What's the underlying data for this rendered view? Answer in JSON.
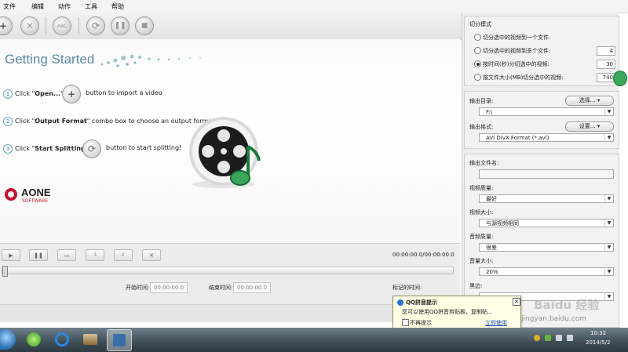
{
  "menu": {
    "items": [
      "文件",
      "编辑",
      "动作",
      "工具",
      "帮助"
    ]
  },
  "toolbar": {
    "text_button": "ABC"
  },
  "getting_started": {
    "title": "Getting Started",
    "steps": [
      {
        "num": "1",
        "pre": "Click \"",
        "bold": "Open...",
        "post": "\"",
        "after": "button to import a video"
      },
      {
        "num": "2",
        "pre": "Click \"",
        "bold": "Output Format",
        "post": "\" combo box to choose an output format",
        "after": ""
      },
      {
        "num": "3",
        "pre": "Click \"",
        "bold": "Start Splitting",
        "post": "\"",
        "after": "button to start splitting!"
      }
    ],
    "logo_text": "AONE",
    "logo_sub": "SOFTWARE"
  },
  "player": {
    "time_display": "00:00:00.0/00:00:00.0",
    "start_label": "开始时间:",
    "start_value": "00:00:00.0",
    "end_label": "结束时间:",
    "end_value": "00:00:00.0",
    "mark_label": "标记的时间:",
    "progress": 0
  },
  "split_mode": {
    "title": "切分模式",
    "options": [
      {
        "label": "切分选中的视频到一个文件.",
        "selected": false,
        "value": ""
      },
      {
        "label": "切分选中的视频到多个文件:",
        "selected": false,
        "value": "4"
      },
      {
        "label": "按时间(秒)分切选中的视频:",
        "selected": true,
        "value": "30"
      },
      {
        "label": "按文件大小(MB)切分选中的视频:",
        "selected": false,
        "value": "740"
      }
    ]
  },
  "output": {
    "dir_label": "输出目录:",
    "dir_button": "选择...",
    "dir_value": "F:\\",
    "format_label": "输出格式:",
    "format_button": "设置...",
    "format_value": "AVI DivX Format (*.avi)"
  },
  "settings": {
    "filename_label": "输出文件名:",
    "filename_value": "",
    "video_quality_label": "视频质量:",
    "video_quality_value": "最好",
    "video_size_label": "视频大小:",
    "video_size_value": "与源视频相同",
    "audio_quality_label": "音频质量:",
    "audio_quality_value": "很差",
    "volume_label": "音量大小:",
    "volume_value": "20%",
    "black_border_label": "黑边:"
  },
  "popup": {
    "title": "QQ拼音提示",
    "message": "您可以使用QQ拼音剪贴板，复制贴...",
    "checkbox_label": "不再提示",
    "link": "立即使用"
  },
  "taskbar": {
    "time": "10:32",
    "date": "2014/5/2"
  },
  "watermark": {
    "text": "Baidu 经验",
    "url": "jingyan.baidu.com"
  },
  "colors": {
    "accent": "#5d8aa3",
    "taskbar": "#3e4d56",
    "popup_bg": "#ffffe6"
  }
}
